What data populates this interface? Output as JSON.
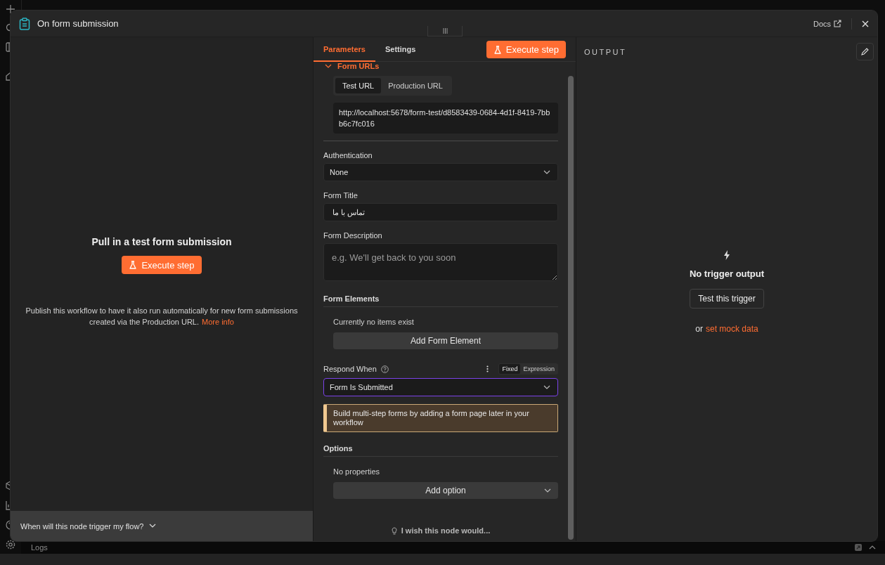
{
  "node_window": {
    "title": "On form submission",
    "docs_link": "Docs"
  },
  "input_panel": {
    "heading": "Pull in a test form submission",
    "execute_button": "Execute step",
    "note": "Publish this workflow to have it also run automatically for new form submissions created via the Production URL.",
    "note_link": "More info",
    "help_toggle": "When will this node trigger my flow?"
  },
  "parameters_panel": {
    "tabs": [
      {
        "label": "Parameters",
        "selected": true
      },
      {
        "label": "Settings",
        "selected": false
      }
    ],
    "execute_button": "Execute step",
    "form_urls": {
      "label": "Form URLs",
      "expanded": true,
      "url_tabs": [
        {
          "label": "Test URL",
          "selected": true
        },
        {
          "label": "Production URL",
          "selected": false
        }
      ],
      "url": "http://localhost:5678/form-test/d8583439-0684-4d1f-8419-7bbb6c7fc016"
    },
    "fields": [
      {
        "kind": "select",
        "label": "Authentication",
        "value": "None"
      },
      {
        "kind": "text",
        "label": "Form Title",
        "value": "تماس با ما"
      },
      {
        "kind": "textarea",
        "label": "Form Description",
        "placeholder": "e.g. We'll get back to you soon"
      }
    ],
    "form_elements": {
      "label": "Form Elements",
      "empty_text": "Currently no items exist",
      "add_button": "Add Form Element"
    },
    "respond_when": {
      "label": "Respond When",
      "modes": [
        {
          "label": "Fixed",
          "selected": true
        },
        {
          "label": "Expression",
          "selected": false
        }
      ],
      "value": "Form Is Submitted",
      "focused": true
    },
    "notice": "Build multi-step forms by adding a form page later in your workflow",
    "options": {
      "label": "Options",
      "empty_text": "No properties",
      "add_button": "Add option"
    },
    "feedback_link": "I wish this node would..."
  },
  "output_panel": {
    "title": "OUTPUT",
    "empty_title": "No trigger output",
    "test_button": "Test this trigger",
    "mock_prefix": "or",
    "mock_link": "set mock data"
  },
  "logs_bar": {
    "label": "Logs"
  }
}
